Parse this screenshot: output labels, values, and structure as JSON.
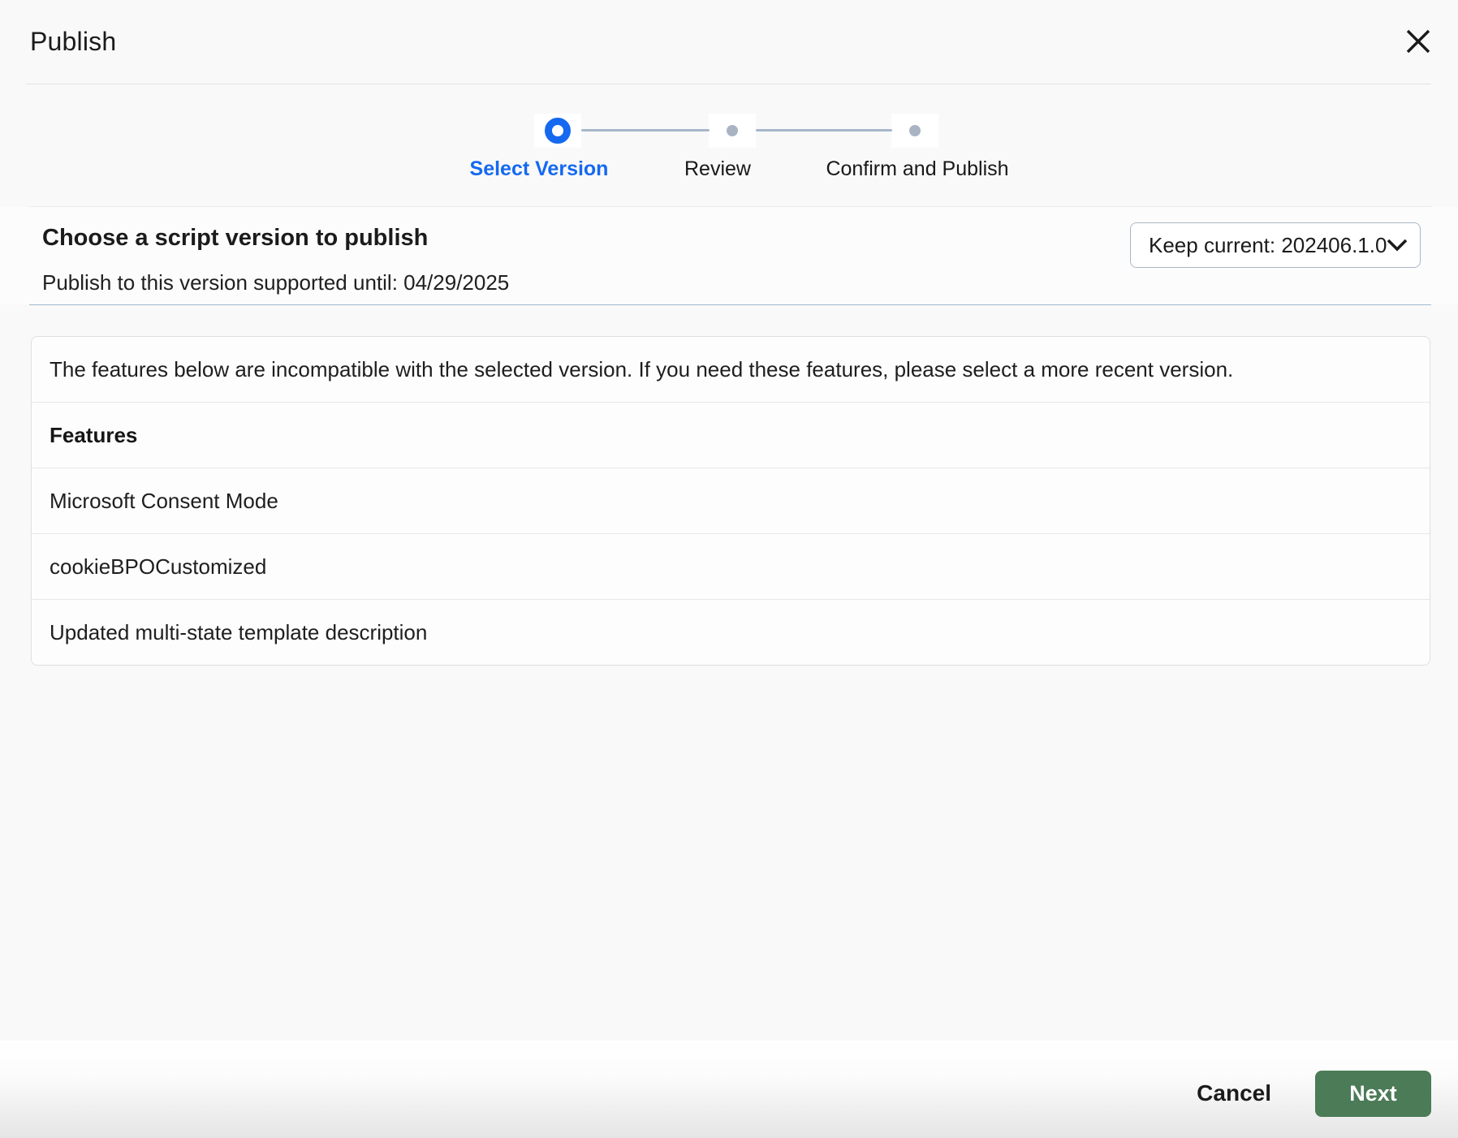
{
  "modal": {
    "title": "Publish"
  },
  "stepper": {
    "steps": [
      {
        "label": "Select Version",
        "state": "active"
      },
      {
        "label": "Review",
        "state": "upcoming"
      },
      {
        "label": "Confirm and Publish",
        "state": "upcoming"
      }
    ]
  },
  "version_section": {
    "heading": "Choose a script version to publish",
    "supported_until_text": "Publish to this version supported until: 04/29/2025",
    "version_dropdown": {
      "value": "Keep current: 202406.1.0",
      "icon": "chevron-down"
    }
  },
  "features_panel": {
    "notice": "The features below are incompatible with the selected version. If you need these features, please select a more recent version.",
    "column_header": "Features",
    "rows": [
      "Microsoft Consent Mode",
      "cookieBPOCustomized",
      "Updated multi-state template description"
    ]
  },
  "footer": {
    "cancel_label": "Cancel",
    "next_label": "Next"
  },
  "colors": {
    "accent_blue": "#1569f0",
    "inactive_step_gray": "#a9b4c3",
    "stepper_line": "#a6b7ca",
    "section_divider_blue": "#a0b9cd",
    "next_button_green": "#4b7b57"
  }
}
